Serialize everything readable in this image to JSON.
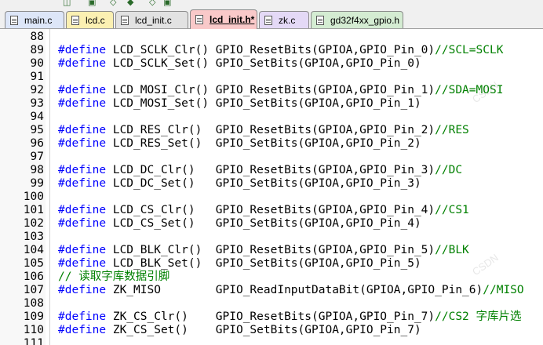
{
  "tabs": [
    {
      "label": "main.c",
      "color": "#dde6f8",
      "active": false
    },
    {
      "label": "lcd.c",
      "color": "#fbf0b2",
      "active": false
    },
    {
      "label": "lcd_init.c",
      "color": "#e2e2e2",
      "active": false
    },
    {
      "label": "lcd_init.h*",
      "color": "#f9c9c9",
      "active": true
    },
    {
      "label": "zk.c",
      "color": "#e4d9f6",
      "active": false
    },
    {
      "label": "gd32f4xx_gpio.h",
      "color": "#d4ecd2",
      "active": false
    }
  ],
  "code": [
    {
      "n": "88",
      "parts": []
    },
    {
      "n": "89",
      "parts": [
        {
          "t": "#define",
          "c": "kw"
        },
        {
          "t": " LCD_SCLK_Clr() GPIO_ResetBits(GPIOA,GPIO_Pin_0)"
        },
        {
          "t": "//SCL=SCLK",
          "c": "cm"
        }
      ]
    },
    {
      "n": "90",
      "parts": [
        {
          "t": "#define",
          "c": "kw"
        },
        {
          "t": " LCD_SCLK_Set() GPIO_SetBits(GPIOA,GPIO_Pin_0)"
        }
      ]
    },
    {
      "n": "91",
      "parts": []
    },
    {
      "n": "92",
      "parts": [
        {
          "t": "#define",
          "c": "kw"
        },
        {
          "t": " LCD_MOSI_Clr() GPIO_ResetBits(GPIOA,GPIO_Pin_1)"
        },
        {
          "t": "//SDA=MOSI",
          "c": "cm"
        }
      ]
    },
    {
      "n": "93",
      "parts": [
        {
          "t": "#define",
          "c": "kw"
        },
        {
          "t": " LCD_MOSI_Set() GPIO_SetBits(GPIOA,GPIO_Pin_1)"
        }
      ]
    },
    {
      "n": "94",
      "parts": []
    },
    {
      "n": "95",
      "parts": [
        {
          "t": "#define",
          "c": "kw"
        },
        {
          "t": " LCD_RES_Clr()  GPIO_ResetBits(GPIOA,GPIO_Pin_2)"
        },
        {
          "t": "//RES",
          "c": "cm"
        }
      ]
    },
    {
      "n": "96",
      "parts": [
        {
          "t": "#define",
          "c": "kw"
        },
        {
          "t": " LCD_RES_Set()  GPIO_SetBits(GPIOA,GPIO_Pin_2)"
        }
      ]
    },
    {
      "n": "97",
      "parts": []
    },
    {
      "n": "98",
      "parts": [
        {
          "t": "#define",
          "c": "kw"
        },
        {
          "t": " LCD_DC_Clr()   GPIO_ResetBits(GPIOA,GPIO_Pin_3)"
        },
        {
          "t": "//DC",
          "c": "cm"
        }
      ]
    },
    {
      "n": "99",
      "parts": [
        {
          "t": "#define",
          "c": "kw"
        },
        {
          "t": " LCD_DC_Set()   GPIO_SetBits(GPIOA,GPIO_Pin_3)"
        }
      ]
    },
    {
      "n": "100",
      "parts": []
    },
    {
      "n": "101",
      "parts": [
        {
          "t": "#define",
          "c": "kw"
        },
        {
          "t": " LCD_CS_Clr()   GPIO_ResetBits(GPIOA,GPIO_Pin_4)"
        },
        {
          "t": "//CS1",
          "c": "cm"
        }
      ]
    },
    {
      "n": "102",
      "parts": [
        {
          "t": "#define",
          "c": "kw"
        },
        {
          "t": " LCD_CS_Set()   GPIO_SetBits(GPIOA,GPIO_Pin_4)"
        }
      ]
    },
    {
      "n": "103",
      "parts": []
    },
    {
      "n": "104",
      "parts": [
        {
          "t": "#define",
          "c": "kw"
        },
        {
          "t": " LCD_BLK_Clr()  GPIO_ResetBits(GPIOA,GPIO_Pin_5)"
        },
        {
          "t": "//BLK",
          "c": "cm"
        }
      ]
    },
    {
      "n": "105",
      "parts": [
        {
          "t": "#define",
          "c": "kw"
        },
        {
          "t": " LCD_BLK_Set()  GPIO_SetBits(GPIOA,GPIO_Pin_5)"
        }
      ]
    },
    {
      "n": "106",
      "parts": [
        {
          "t": "// 读取字库数据引脚",
          "c": "cm"
        }
      ]
    },
    {
      "n": "107",
      "parts": [
        {
          "t": "#define",
          "c": "kw"
        },
        {
          "t": " ZK_MISO        GPIO_ReadInputDataBit(GPIOA,GPIO_Pin_6)"
        },
        {
          "t": "//MISO",
          "c": "cm"
        }
      ]
    },
    {
      "n": "108",
      "parts": []
    },
    {
      "n": "109",
      "parts": [
        {
          "t": "#define",
          "c": "kw"
        },
        {
          "t": " ZK_CS_Clr()    GPIO_ResetBits(GPIOA,GPIO_Pin_7)"
        },
        {
          "t": "//CS2 字库片选",
          "c": "cm"
        }
      ]
    },
    {
      "n": "110",
      "parts": [
        {
          "t": "#define",
          "c": "kw"
        },
        {
          "t": " ZK_CS_Set()    GPIO_SetBits(GPIOA,GPIO_Pin_7)"
        }
      ]
    },
    {
      "n": "111",
      "parts": []
    }
  ],
  "colors": {
    "keyword": "#0000ff",
    "comment": "#008000",
    "text": "#000000"
  }
}
